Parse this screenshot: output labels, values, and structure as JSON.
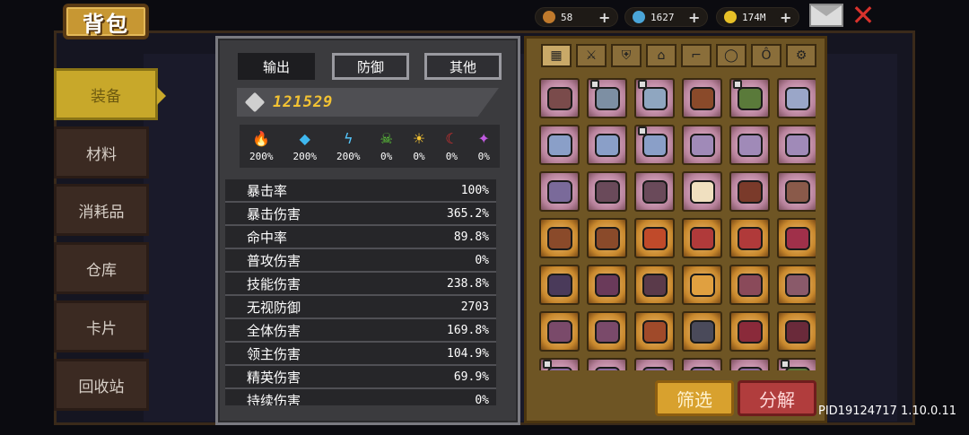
{
  "title": "背包",
  "currencies": [
    {
      "name": "wood",
      "icon": "wood-icon",
      "value": "58",
      "color": "#c07a2c"
    },
    {
      "name": "gem",
      "icon": "gem-icon",
      "value": "1627",
      "color": "#4aa5d8"
    },
    {
      "name": "gold",
      "icon": "gold-coin-icon",
      "value": "174M",
      "color": "#e7c027"
    }
  ],
  "side_tabs": [
    {
      "label": "装备",
      "active": true
    },
    {
      "label": "材料"
    },
    {
      "label": "消耗品"
    },
    {
      "label": "仓库"
    },
    {
      "label": "卡片"
    },
    {
      "label": "回收站"
    }
  ],
  "stat_tabs": [
    {
      "label": "输出",
      "active": true
    },
    {
      "label": "防御"
    },
    {
      "label": "其他"
    }
  ],
  "power": "121529",
  "elements": [
    {
      "icon": "fire-icon",
      "glyph": "🔥",
      "value": "200%",
      "color": "#ff6a1a"
    },
    {
      "icon": "ice-icon",
      "glyph": "◆",
      "value": "200%",
      "color": "#3fb8f0"
    },
    {
      "icon": "lightning-icon",
      "glyph": "ϟ",
      "value": "200%",
      "color": "#55c8ff"
    },
    {
      "icon": "poison-skull-icon",
      "glyph": "☠",
      "value": "0%",
      "color": "#5fce3a"
    },
    {
      "icon": "sun-icon",
      "glyph": "☀",
      "value": "0%",
      "color": "#f3c233"
    },
    {
      "icon": "moon-icon",
      "glyph": "☾",
      "value": "0%",
      "color": "#e03030"
    },
    {
      "icon": "arcane-icon",
      "glyph": "✦",
      "value": "0%",
      "color": "#c05ae0"
    }
  ],
  "stats": [
    {
      "label": "暴击率",
      "value": "100%"
    },
    {
      "label": "暴击伤害",
      "value": "365.2%"
    },
    {
      "label": "命中率",
      "value": "89.8%"
    },
    {
      "label": "普攻伤害",
      "value": "0%"
    },
    {
      "label": "技能伤害",
      "value": "238.8%"
    },
    {
      "label": "无视防御",
      "value": "2703"
    },
    {
      "label": "全体伤害",
      "value": "169.8%"
    },
    {
      "label": "领主伤害",
      "value": "104.9%"
    },
    {
      "label": "精英伤害",
      "value": "69.9%"
    },
    {
      "label": "持续伤害",
      "value": "0%"
    }
  ],
  "inventory_tabs": [
    {
      "icon": "grid-all-icon",
      "glyph": "▦",
      "active": true
    },
    {
      "icon": "weapon-icon",
      "glyph": "⚔"
    },
    {
      "icon": "armor-icon",
      "glyph": "⛨"
    },
    {
      "icon": "helmet-icon",
      "glyph": "⌂"
    },
    {
      "icon": "boots-icon",
      "glyph": "⌐"
    },
    {
      "icon": "ring-icon",
      "glyph": "◯"
    },
    {
      "icon": "necklace-icon",
      "glyph": "Ô"
    },
    {
      "icon": "gear-icon",
      "glyph": "⚙"
    }
  ],
  "inventory_items": [
    {
      "rarity": "pink",
      "color": "#7a4b4b",
      "locked": false
    },
    {
      "rarity": "pink",
      "color": "#7d8fa3",
      "locked": true
    },
    {
      "rarity": "pink",
      "color": "#8fa6c0",
      "locked": true
    },
    {
      "rarity": "pink",
      "color": "#8a4a2a",
      "locked": false
    },
    {
      "rarity": "pink",
      "color": "#5a7a3a",
      "locked": true
    },
    {
      "rarity": "pink",
      "color": "#9aa6c8",
      "locked": false
    },
    {
      "rarity": "pink",
      "color": "#8a9fc8",
      "locked": false
    },
    {
      "rarity": "pink",
      "color": "#8a9fc8",
      "locked": false
    },
    {
      "rarity": "pink",
      "color": "#8a9fc8",
      "locked": true
    },
    {
      "rarity": "pink",
      "color": "#a08ab8",
      "locked": false
    },
    {
      "rarity": "pink",
      "color": "#a08ab8",
      "locked": false
    },
    {
      "rarity": "pink",
      "color": "#a08ab8",
      "locked": false
    },
    {
      "rarity": "pink",
      "color": "#7a6a9a",
      "locked": false
    },
    {
      "rarity": "pink",
      "color": "#6a4a5a",
      "locked": false
    },
    {
      "rarity": "pink",
      "color": "#6a4a5a",
      "locked": false
    },
    {
      "rarity": "pink",
      "color": "#f0e0c0",
      "locked": false
    },
    {
      "rarity": "pink",
      "color": "#7a3a2a",
      "locked": false
    },
    {
      "rarity": "pink",
      "color": "#8a5a4a",
      "locked": false
    },
    {
      "rarity": "gold",
      "color": "#8a4a2a",
      "locked": false
    },
    {
      "rarity": "gold",
      "color": "#8a4a2a",
      "locked": false
    },
    {
      "rarity": "gold",
      "color": "#c04a2a",
      "locked": false
    },
    {
      "rarity": "gold",
      "color": "#b03a3a",
      "locked": false
    },
    {
      "rarity": "gold",
      "color": "#b03a3a",
      "locked": false
    },
    {
      "rarity": "gold",
      "color": "#a0304a",
      "locked": false
    },
    {
      "rarity": "gold",
      "color": "#4a3a5a",
      "locked": false
    },
    {
      "rarity": "gold",
      "color": "#6a3a5a",
      "locked": false
    },
    {
      "rarity": "gold",
      "color": "#5a3a4a",
      "locked": false
    },
    {
      "rarity": "gold",
      "color": "#e0a040",
      "locked": false
    },
    {
      "rarity": "gold",
      "color": "#8a4a5a",
      "locked": false
    },
    {
      "rarity": "gold",
      "color": "#8a5a6a",
      "locked": false
    },
    {
      "rarity": "gold",
      "color": "#7a4a6a",
      "locked": false
    },
    {
      "rarity": "gold",
      "color": "#7a4a6a",
      "locked": false
    },
    {
      "rarity": "gold",
      "color": "#a04a2a",
      "locked": false
    },
    {
      "rarity": "gold",
      "color": "#4a4a5a",
      "locked": false
    },
    {
      "rarity": "gold",
      "color": "#8a2a3a",
      "locked": false
    },
    {
      "rarity": "gold",
      "color": "#6a2a3a",
      "locked": false
    },
    {
      "rarity": "pink",
      "color": "#8a6aa0",
      "locked": true
    },
    {
      "rarity": "pink",
      "color": "#8a6aa0",
      "locked": false
    },
    {
      "rarity": "pink",
      "color": "#8a6aa0",
      "locked": false
    },
    {
      "rarity": "pink",
      "color": "#8a6aa0",
      "locked": false
    },
    {
      "rarity": "pink",
      "color": "#8a6aa0",
      "locked": false
    },
    {
      "rarity": "pink",
      "color": "#5a7a3a",
      "locked": true
    }
  ],
  "buttons": {
    "filter": "筛选",
    "decompose": "分解"
  },
  "version": "PID19124717 1.10.0.11"
}
